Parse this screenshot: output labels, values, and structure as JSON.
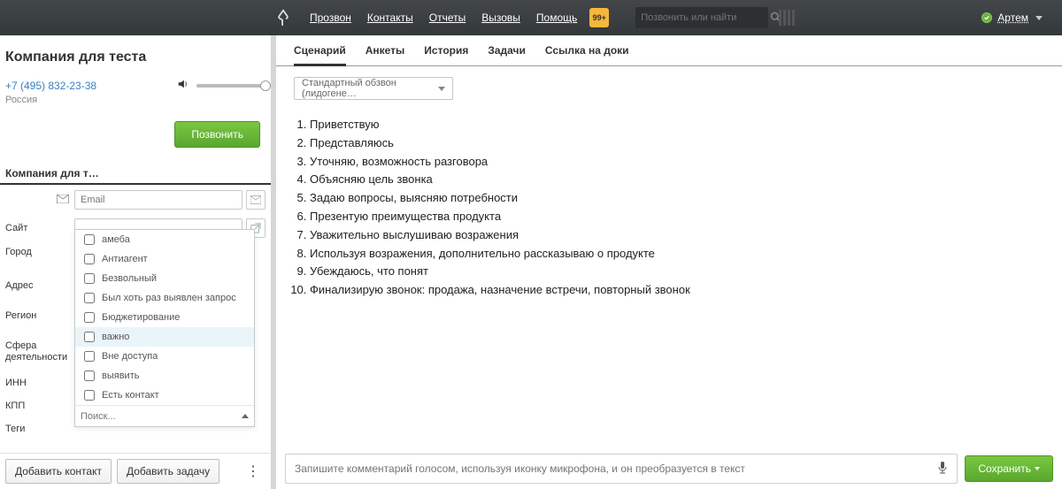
{
  "topbar": {
    "nav": [
      "Прозвон",
      "Контакты",
      "Отчеты",
      "Вызовы",
      "Помощь"
    ],
    "notif_badge": "99+",
    "search_placeholder": "Позвонить или найти",
    "user_name": "Артем"
  },
  "left": {
    "company_title": "Компания для теста",
    "phone": "+7 (495) 832-23-38",
    "country": "Россия",
    "call_button": "Позвонить",
    "tab_label": "Компания для т…",
    "fields": {
      "email_label": "",
      "email_placeholder": "Email",
      "site_label": "Сайт",
      "city_label": "Город",
      "address_label": "Адрес",
      "region_label": "Регион",
      "sphere_label": "Сфера деятельности",
      "inn_label": "ИНН",
      "kpp_label": "КПП",
      "tags_label": "Теги"
    },
    "tag_options": [
      "амеба",
      "Антиагент",
      "Безвольный",
      "Был хоть раз выявлен запрос",
      "Бюджетирование",
      "важно",
      "Вне доступа",
      "выявить",
      "Есть контакт"
    ],
    "tag_search_placeholder": "Поиск...",
    "add_contact": "Добавить контакт",
    "add_task": "Добавить задачу"
  },
  "right": {
    "tabs": [
      "Сценарий",
      "Анкеты",
      "История",
      "Задачи",
      "Ссылка на доки"
    ],
    "active_tab_index": 0,
    "select_value": "Стандартный обзвон (лидогене…",
    "script_steps": [
      "Приветствую",
      "Представляюсь",
      "Уточняю, возможность разговора",
      "Объясняю цель звонка",
      "Задаю вопросы, выясняю потребности",
      "Презентую преимущества продукта",
      "Уважительно выслушиваю возражения",
      "Используя возражения, дополнительно рассказываю о продукте",
      "Убеждаюсь, что понят",
      "Финализирую звонок: продажа, назначение встречи, повторный звонок"
    ],
    "comment_placeholder": "Запишите комментарий голосом, используя иконку микрофона, и он преобразуется в текст",
    "save_button": "Сохранить"
  }
}
